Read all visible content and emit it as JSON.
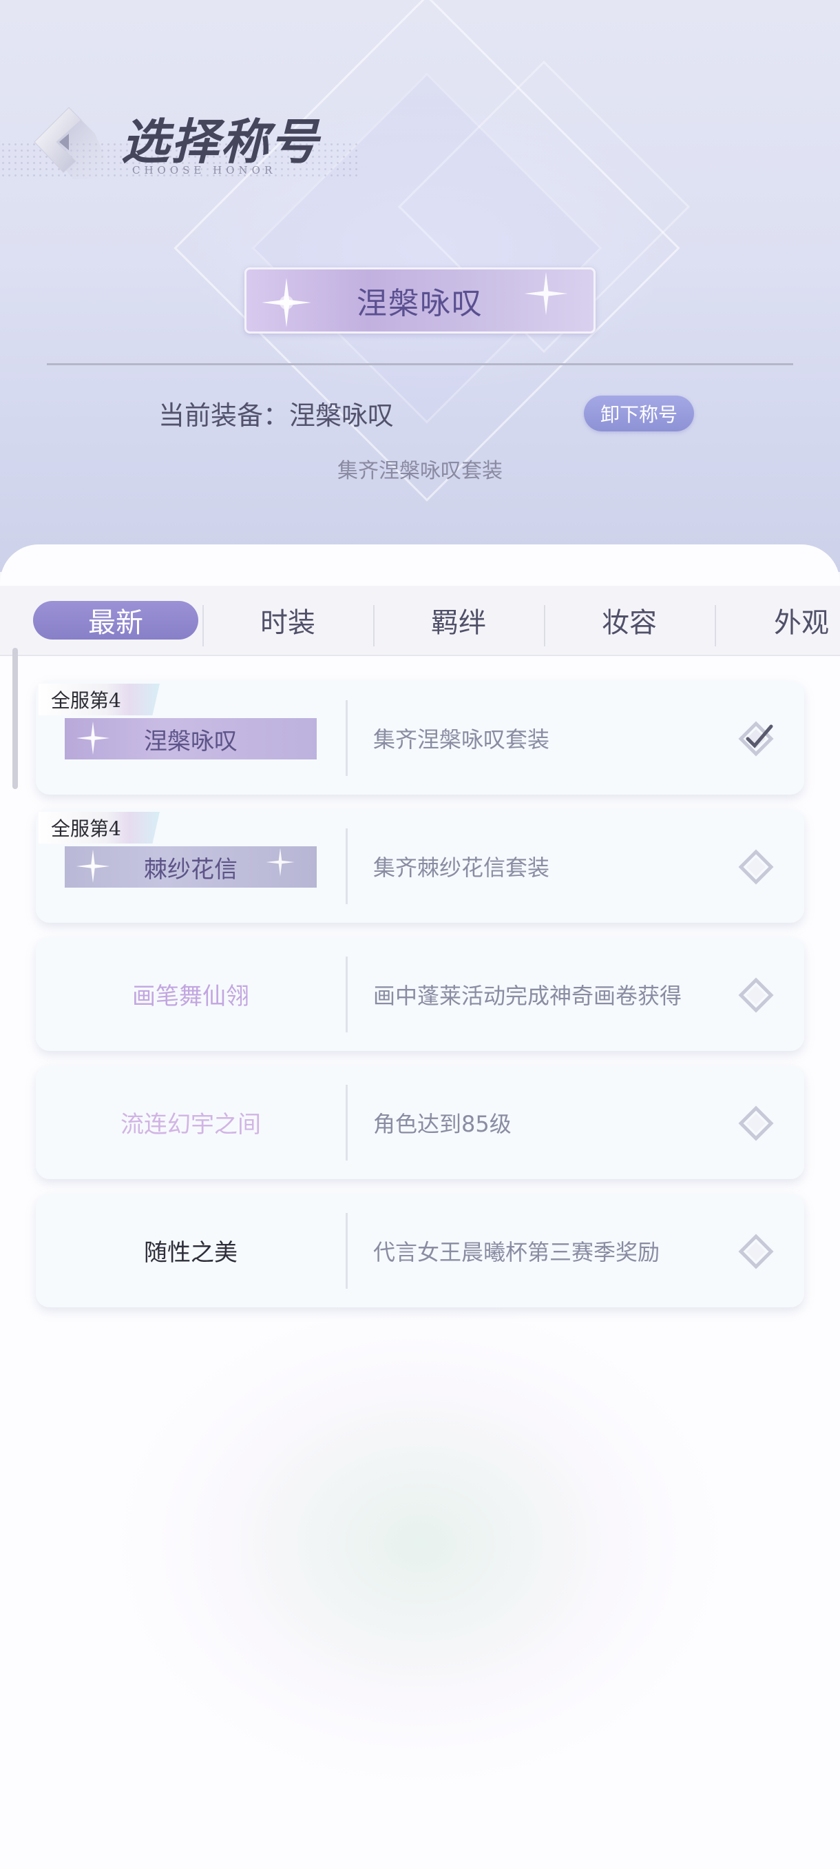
{
  "header": {
    "title": "选择称号",
    "subtitle": "CHOOSE HONOR",
    "back_icon": "chevron-left-icon"
  },
  "current": {
    "plate_title": "涅槃咏叹",
    "equip_label": "当前装备：涅槃咏叹",
    "unequip_label": "卸下称号",
    "description": "集齐涅槃咏叹套装"
  },
  "tabs": [
    {
      "label": "最新",
      "active": true
    },
    {
      "label": "时装",
      "active": false
    },
    {
      "label": "羁绊",
      "active": false
    },
    {
      "label": "妆容",
      "active": false
    },
    {
      "label": "外观",
      "active": false
    }
  ],
  "honors": [
    {
      "rank": "全服第4",
      "name": "涅槃咏叹",
      "condition": "集齐涅槃咏叹套装",
      "style": "plate",
      "checked": true
    },
    {
      "rank": "全服第4",
      "name": "棘纱花信",
      "condition": "集齐棘纱花信套装",
      "style": "plate-gray",
      "checked": false
    },
    {
      "rank": "",
      "name": "画笔舞仙翎",
      "condition": "画中蓬莱活动完成神奇画卷获得",
      "style": "text",
      "text_color": "#c3a6e0",
      "checked": false
    },
    {
      "rank": "",
      "name": "流连幻宇之间",
      "condition": "角色达到85级",
      "style": "text",
      "text_color": "#d2b4e4",
      "checked": false
    },
    {
      "rank": "",
      "name": "随性之美",
      "condition": "代言女王晨曦杯第三赛季奖励",
      "style": "text",
      "text_color": "#2e2e3a",
      "checked": false
    }
  ],
  "colors": {
    "accent": "#8d92d6",
    "tab_active": "#9189d0"
  }
}
